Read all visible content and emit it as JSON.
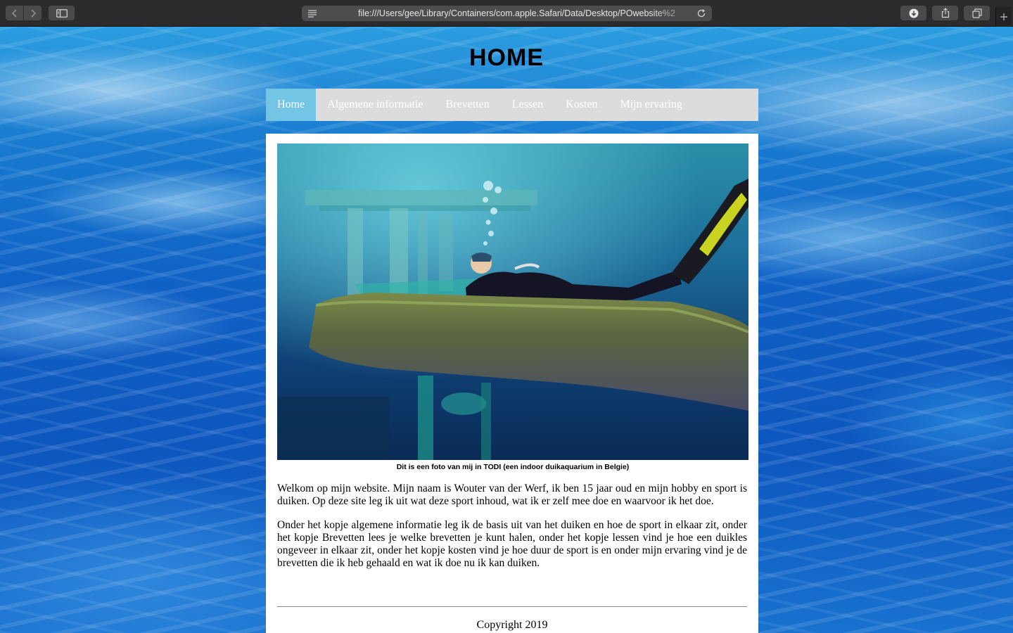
{
  "browser": {
    "url": "file:///Users/gee/Library/Containers/com.apple.Safari/Data/Desktop/POwebsite%2",
    "icons": {
      "back": "chevron-left-icon",
      "forward": "chevron-right-icon",
      "sidebar": "sidebar-icon",
      "reader": "reader-icon",
      "reload": "reload-icon",
      "downloads": "download-icon",
      "share": "share-icon",
      "tabs": "tabs-overview-icon",
      "new_tab": "plus-icon"
    }
  },
  "page": {
    "title": "HOME",
    "nav": [
      {
        "label": "Home",
        "active": true
      },
      {
        "label": "Algemene informatie",
        "active": false
      },
      {
        "label": "Brevetten",
        "active": false
      },
      {
        "label": "Lessen",
        "active": false
      },
      {
        "label": "Kosten",
        "active": false
      },
      {
        "label": "Mijn ervaring",
        "active": false
      }
    ],
    "photo_caption": "Dit is een foto van mij in TODI (een indoor duikaquarium in Belgie)",
    "intro": "Welkom op mijn website. Mijn naam is Wouter van der Werf, ik ben 15 jaar oud en mijn hobby en sport is duiken. Op deze site leg ik uit wat deze sport inhoud, wat ik er zelf mee doe en waarvoor ik het doe.",
    "info": "Onder het kopje algemene informatie leg ik de basis uit van het duiken en hoe de sport in elkaar zit, onder het kopje Brevetten lees je welke brevetten je kunt halen, onder het kopje lessen vind je hoe een duikles ongeveer in elkaar zit, onder het kopje kosten vind je hoe duur de sport is en onder mijn ervaring vind je de brevetten die ik heb gehaald en wat ik doe nu ik kan duiken.",
    "footer": "Copyright 2019"
  },
  "colors": {
    "nav_bg": "#dcdcdc",
    "nav_active": "#74c4e6",
    "nav_text": "#ffffff",
    "content_bg": "#ffffff",
    "toolbar_bg": "#2b2b2d"
  }
}
